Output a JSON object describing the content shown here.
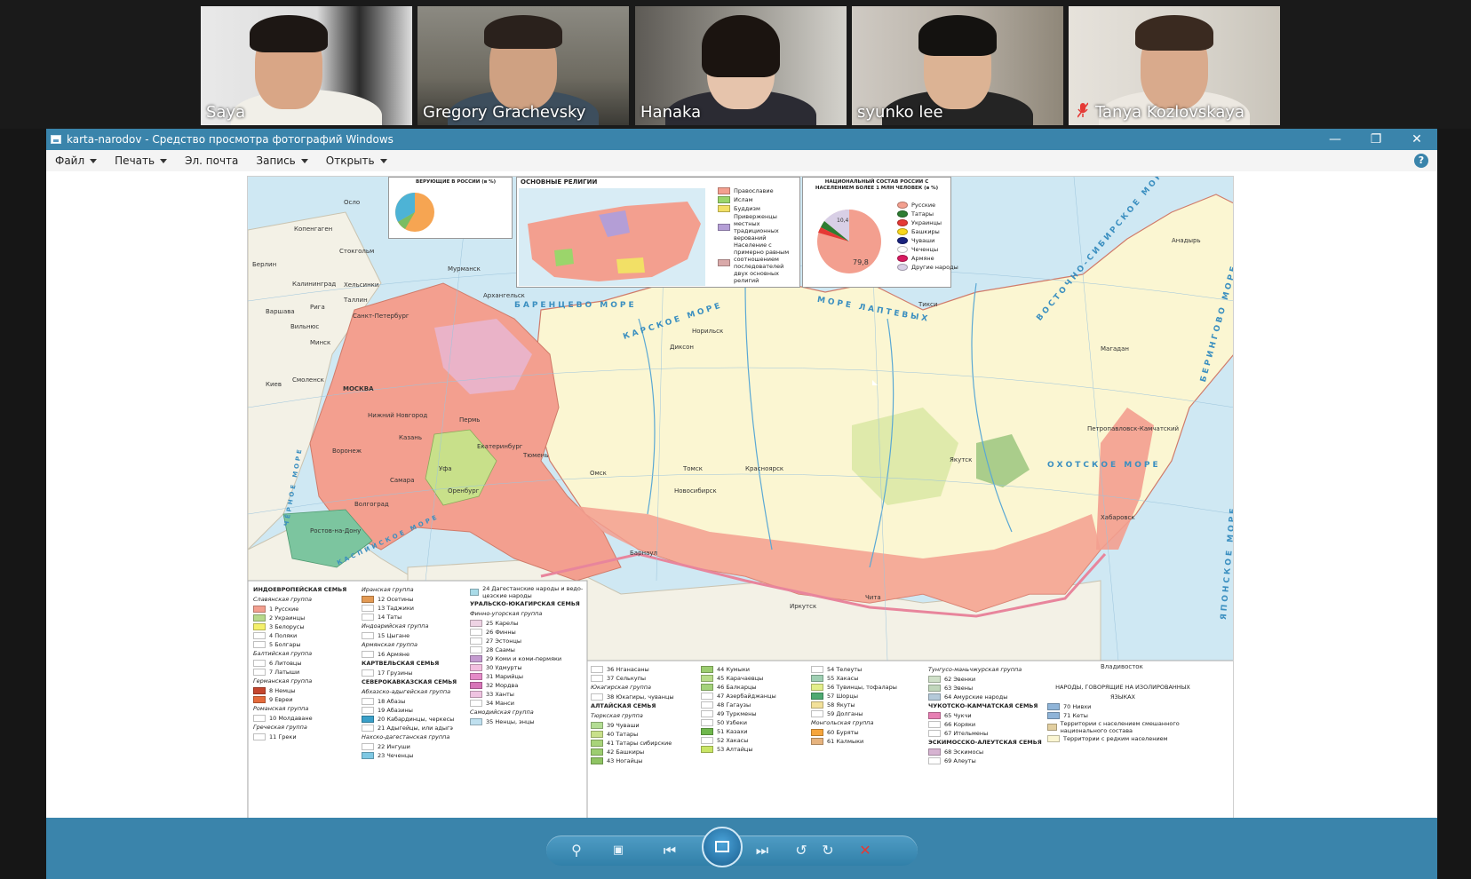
{
  "participants": [
    {
      "name": "Saya",
      "muted": false,
      "active": false
    },
    {
      "name": "Gregory Grachevsky",
      "muted": false,
      "active": true
    },
    {
      "name": "Hanaka",
      "muted": false,
      "active": false
    },
    {
      "name": "syunko lee",
      "muted": false,
      "active": false
    },
    {
      "name": "Tanya Kozlovskaya",
      "muted": true,
      "active": false
    }
  ],
  "window": {
    "title": "karta-narodov - Средство просмотра фотографий Windows",
    "menu": [
      "Файл",
      "Печать",
      "Эл. почта",
      "Запись",
      "Открыть"
    ],
    "help": "?"
  },
  "map": {
    "inset_religions_title": "ОСНОВНЫЕ РЕЛИГИИ",
    "inset_believers_title": "ВЕРУЮЩИЕ В РОССИИ (в %)",
    "inset_composition_title": "НАЦИОНАЛЬНЫЙ СОСТАВ РОССИИ С НАСЕЛЕНИЕМ БОЛЕЕ 1 МЛН ЧЕЛОВЕК (в %)",
    "religions_legend": [
      "Православие",
      "Ислам",
      "Буддизм",
      "Приверженцы местных традиционных верований",
      "Население с примерно равным соотношением последователей двух основных религий"
    ],
    "composition_legend": [
      "Русские",
      "Татары",
      "Украинцы",
      "Башкиры",
      "Чуваши",
      "Чеченцы",
      "Армяне",
      "Другие народы"
    ],
    "composition_values": {
      "russians": "79,8",
      "others": "10,4"
    },
    "cities": [
      "МОСКВА",
      "Санкт-Петербург",
      "Нижний Новгород",
      "Казань",
      "Самара",
      "Ростов-на-Дону",
      "Волгоград",
      "Екатеринбург",
      "Новосибирск",
      "Омск",
      "Красноярск",
      "Иркутск",
      "Якутск",
      "Хабаровск",
      "Владивосток",
      "Мурманск",
      "Архангельск",
      "Магадан",
      "Петропавловск-Камчатский",
      "Чита",
      "Норильск",
      "Барнаул",
      "Томск",
      "Тюмень",
      "Пермь",
      "Уфа",
      "Оренбург",
      "Воронеж",
      "Смоленск",
      "Калининград",
      "Хельсинки",
      "Рига",
      "Минск",
      "Киев",
      "Таллин",
      "Стокгольм",
      "Осло",
      "Копенгаген",
      "Берлин",
      "Варшава",
      "Вильнюс",
      "Анадырь",
      "Тикси",
      "Диксон"
    ],
    "seas": [
      "БАРЕНЦЕВО МОРЕ",
      "КАРСКОЕ МОРЕ",
      "МОРЕ ЛАПТЕВЫХ",
      "ВОСТОЧНО-СИБИРСКОЕ МОРЕ",
      "ОХОТСКОЕ МОРЕ",
      "БЕРИНГОВО МОРЕ",
      "ЯПОНСКОЕ МОРЕ",
      "КАСПИЙСКОЕ МОРЕ",
      "ЧЁРНОЕ МОРЕ"
    ],
    "legend": {
      "col1": [
        "ИНДОЕВРОПЕЙСКАЯ СЕМЬЯ",
        "Славянская группа",
        "1 Русские",
        "2 Украинцы",
        "3 Белорусы",
        "4 Поляки",
        "5 Болгары",
        "Балтийская группа",
        "6 Литовцы",
        "7 Латыши",
        "Германская группа",
        "8 Немцы",
        "9 Евреи",
        "Романская группа",
        "10 Молдаване",
        "Греческая группа",
        "11 Греки"
      ],
      "col2": [
        "Иранская группа",
        "12 Осетины",
        "13 Таджики",
        "14 Таты",
        "Индоарийская группа",
        "15 Цыгане",
        "Армянская группа",
        "16 Армяне",
        "КАРТВЕЛЬСКАЯ СЕМЬЯ",
        "17 Грузины",
        "СЕВЕРОКАВКАЗСКАЯ СЕМЬЯ",
        "Абхазско-адыгейская группа",
        "18 Абазы",
        "19 Абазины",
        "20 Кабардинцы, черкесы",
        "21 Адыгейцы, или адыгэ",
        "Нахско-дагестанская группа",
        "22 Ингуши",
        "23 Чеченцы"
      ],
      "col3": [
        "24 Дагестанские народы и ведо-цезские народы",
        "УРАЛЬСКО-ЮКАГИРСКАЯ СЕМЬЯ",
        "Финно-угорская группа",
        "25 Карелы",
        "26 Финны",
        "27 Эстонцы",
        "28 Саамы",
        "29 Коми и коми-пермяки",
        "30 Удмурты",
        "31 Марийцы",
        "32 Мордва",
        "33 Ханты",
        "34 Манси",
        "Самодийская группа",
        "35 Ненцы, энцы"
      ],
      "col4": [
        "36 Нганасаны",
        "37 Селькупы",
        "Юкагирская группа",
        "38 Юкагиры, чуванцы",
        "АЛТАЙСКАЯ СЕМЬЯ",
        "Тюркская группа",
        "39 Чуваши",
        "40 Татары",
        "41 Татары сибирские",
        "42 Башкиры",
        "43 Ногайцы"
      ],
      "col5": [
        "44 Кумыки",
        "45 Карачаевцы",
        "46 Балкарцы",
        "47 Азербайджанцы",
        "48 Гагаузы",
        "49 Туркмены",
        "50 Узбеки",
        "51 Казахи",
        "52 Хакасы",
        "53 Алтайцы"
      ],
      "col6": [
        "54 Телеуты",
        "55 Хакасы",
        "56 Тувинцы, тофалары",
        "57 Шорцы",
        "58 Якуты",
        "59 Долганы",
        "Монгольская группа",
        "60 Буряты",
        "61 Калмыки"
      ],
      "col7": [
        "Тунгусо-маньчжурская группа",
        "62 Эвенки",
        "63 Эвены",
        "64 Амурские народы",
        "ЧУКОТСКО-КАМЧАТСКАЯ СЕМЬЯ",
        "65 Чукчи",
        "66 Коряки",
        "67 Ительмены",
        "ЭСКИМОССКО-АЛЕУТСКАЯ СЕМЬЯ",
        "68 Эскимосы",
        "69 Алеуты"
      ],
      "col8": [
        "НАРОДЫ, ГОВОРЯЩИЕ НА ИЗОЛИРОВАННЫХ ЯЗЫКАХ",
        "70 Нивхи",
        "71 Кеты",
        "Территории с населением смешанного национального состава",
        "Территории с редким населением"
      ]
    },
    "colors": {
      "slavic": "#f39f8f",
      "turkic": "#c8e08a",
      "finno_ugric": "#e7b8d6",
      "sparse": "#fbf6d2",
      "caucasus": "#7cc59f",
      "sea": "#cfe8f3",
      "foreign": "#f3f1e6",
      "tungus": "#cfe0c8"
    }
  },
  "colors": {
    "titlebar": "#3a84ab",
    "active_speaker": "#8bc34a",
    "controlbar": "#3a84ab"
  },
  "controls": [
    "zoom",
    "fit",
    "previous",
    "slideshow",
    "next",
    "rotate-left",
    "rotate-right",
    "delete"
  ]
}
